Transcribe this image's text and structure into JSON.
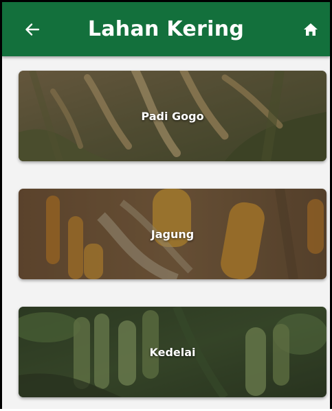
{
  "header": {
    "title": "Lahan Kering",
    "background_color": "#13703c",
    "back_icon": "arrow-left-icon",
    "home_icon": "home-icon"
  },
  "crops": [
    {
      "label": "Padi Gogo",
      "image": "rice-field-photo"
    },
    {
      "label": "Jagung",
      "image": "corn-cob-photo"
    },
    {
      "label": "Kedelai",
      "image": "soybean-pod-photo"
    }
  ]
}
